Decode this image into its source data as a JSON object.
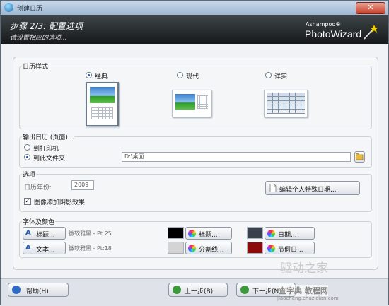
{
  "window": {
    "title": "创建日历",
    "close_label": "✕"
  },
  "header": {
    "step": "步骤 2/3: 配置选项",
    "subtitle": "请设置相应的选项...",
    "brand_small": "Ashampoo®",
    "brand_large": "PhotoWizard"
  },
  "calendar_style": {
    "title": "日历样式",
    "options": [
      {
        "label": "经典",
        "selected": true
      },
      {
        "label": "现代",
        "selected": false
      },
      {
        "label": "详实",
        "selected": false
      }
    ]
  },
  "output": {
    "title": "输出日历 (页面)...",
    "print_label": "到打印机",
    "folder_label": "到此文件夹:",
    "folder_selected": true,
    "folder_path": "D:\\桌面"
  },
  "options": {
    "title": "选项",
    "year_label": "日历年份:",
    "year_value": "2009",
    "edit_dates_button": "编辑个人特殊日期...",
    "shadow_label": "图像添加阴影效果",
    "shadow_checked": true
  },
  "fonts": {
    "title": "字体及颜色",
    "title_button": "标题...",
    "title_font": "微软雅黑 - Pt:25",
    "text_button": "文本...",
    "text_font": "微软雅黑 - Pt:18",
    "color_buttons": {
      "title": "标题...",
      "separator": "分割线...",
      "date": "日期...",
      "holiday": "节假日..."
    },
    "colors": {
      "title": "#000000",
      "separator": "#d4d4d4",
      "date": "#3a3f4c",
      "holiday": "#8b0a0a"
    }
  },
  "footer": {
    "help": "帮助(H)",
    "back": "上一步(B)",
    "next": "下一步(N)"
  },
  "watermark": {
    "line1": "驱动之家",
    "line2": "查字典 教程网",
    "url": "jiaocheng.chazidian.com"
  }
}
